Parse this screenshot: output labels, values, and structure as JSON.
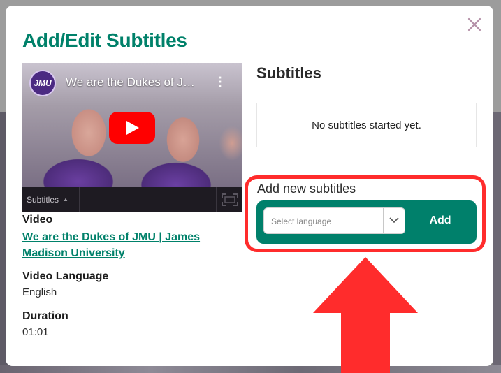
{
  "modal": {
    "title": "Add/Edit Subtitles",
    "close_label": "✕"
  },
  "player": {
    "channel_logo_text": "JMU",
    "video_title": "We are the Dukes of J…",
    "menu_glyph": "⋮",
    "subtitles_button": "Subtitles",
    "subtitles_caret": "▲"
  },
  "details": {
    "video_label": "Video",
    "video_link": "We are the Dukes of JMU | James Madison University",
    "language_label": "Video Language",
    "language_value": "English",
    "duration_label": "Duration",
    "duration_value": "01:01"
  },
  "subtitles": {
    "heading": "Subtitles",
    "empty_message": "No subtitles started yet.",
    "add_new_label": "Add new subtitles",
    "language_placeholder": "Select language",
    "add_button": "Add"
  },
  "colors": {
    "brand": "#00816a",
    "annotation": "#ff2c2c",
    "youtube": "#ff0000"
  },
  "icons": [
    "close-icon",
    "play-icon",
    "chevron-down-icon",
    "fullscreen-icon",
    "menu-kebab-icon",
    "arrow-up-annotation"
  ]
}
